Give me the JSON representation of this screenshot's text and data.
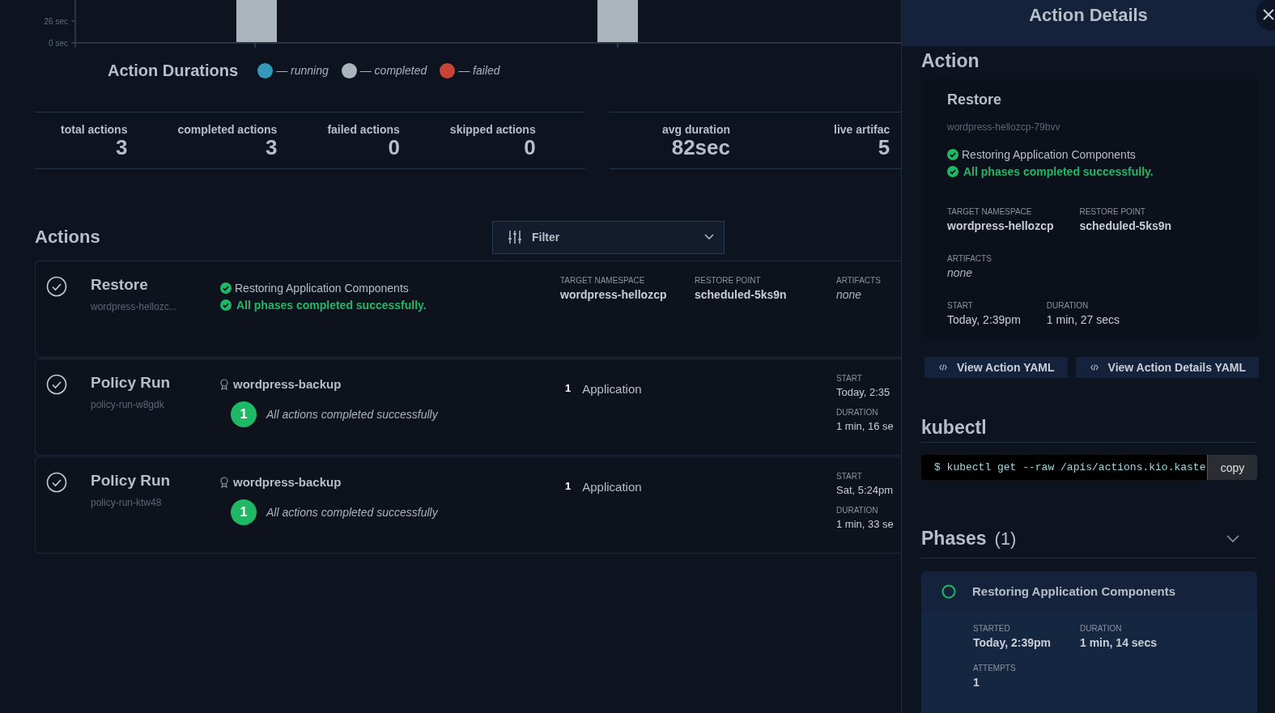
{
  "chart": {
    "yticks": [
      "26 sec",
      "0 sec"
    ]
  },
  "legend": {
    "title": "Action Durations",
    "items": [
      {
        "label": "— running",
        "color": "#3399bb"
      },
      {
        "label": "— completed",
        "color": "#aab4bb"
      },
      {
        "label": "— failed",
        "color": "#c94434"
      }
    ]
  },
  "stats": [
    [
      {
        "label": "total actions",
        "value": "3"
      },
      {
        "label": "completed actions",
        "value": "3"
      },
      {
        "label": "failed actions",
        "value": "0"
      },
      {
        "label": "skipped actions",
        "value": "0"
      }
    ],
    [
      {
        "label": "avg duration",
        "value": "82sec"
      },
      {
        "label": "live artifac",
        "value": "5"
      }
    ]
  ],
  "actions": {
    "title": "Actions",
    "filter": {
      "label": "Filter"
    },
    "rows": [
      {
        "kind": "restore",
        "title": "Restore",
        "subtitle": "wordpress-hellozc...",
        "statuses": [
          {
            "kind": "phase",
            "text": "Restoring Application Components"
          },
          {
            "kind": "summary",
            "text": "All phases completed successfully."
          }
        ],
        "fields": [
          {
            "label": "TARGET NAMESPACE",
            "value": "wordpress-hellozcp"
          },
          {
            "label": "RESTORE POINT",
            "value": "scheduled-5ks9n"
          },
          {
            "label": "ARTIFACTS",
            "value": "none",
            "kind": "empty"
          }
        ]
      },
      {
        "kind": "policy",
        "title": "Policy Run",
        "subtitle": "policy-run-w8gdk",
        "policy": "wordpress-backup",
        "count": "1",
        "result": "All actions completed successfully",
        "app_count": "1",
        "app_label": "Application",
        "fields": [
          {
            "label": "START",
            "value": "Today, 2:35"
          },
          {
            "label": "DURATION",
            "value": "1 min, 16 se"
          }
        ]
      },
      {
        "kind": "policy",
        "title": "Policy Run",
        "subtitle": "policy-run-ktw48",
        "policy": "wordpress-backup",
        "count": "1",
        "result": "All actions completed successfully",
        "app_count": "1",
        "app_label": "Application",
        "fields": [
          {
            "label": "START",
            "value": "Sat, 5:24pm"
          },
          {
            "label": "DURATION",
            "value": "1 min, 33 se"
          }
        ]
      }
    ]
  },
  "panel": {
    "title": "Action Details",
    "section": "Action",
    "action": {
      "title": "Restore",
      "subtitle": "wordpress-hellozcp-79bvv",
      "statuses": [
        {
          "kind": "phase",
          "text": "Restoring Application Components"
        },
        {
          "kind": "summary",
          "text": "All phases completed successfully."
        }
      ],
      "fields": [
        [
          {
            "label": "TARGET NAMESPACE",
            "value": "wordpress-hellozcp"
          },
          {
            "label": "RESTORE POINT",
            "value": "scheduled-5ks9n"
          }
        ],
        [
          {
            "label": "ARTIFACTS",
            "value": "none",
            "kind": "empty"
          }
        ],
        [
          {
            "label": "START",
            "value": "Today, 2:39pm"
          },
          {
            "label": "DURATION",
            "value": "1 min, 27 secs"
          }
        ]
      ]
    },
    "buttons": [
      "View Action YAML",
      "View Action Details YAML"
    ],
    "kubectl": {
      "title": "kubectl",
      "command": "$ kubectl get --raw /apis/actions.kio.kaste",
      "copy": "copy"
    },
    "phases": {
      "title": "Phases",
      "count": "(1)",
      "expanded": true,
      "items": [
        {
          "name": "Restoring Application Components",
          "fields": [
            [
              {
                "label": "STARTED",
                "value": "Today, 2:39pm"
              },
              {
                "label": "DURATION",
                "value": "1 min, 14 secs"
              }
            ],
            [
              {
                "label": "ATTEMPTS",
                "value": "1"
              }
            ]
          ]
        }
      ]
    }
  }
}
